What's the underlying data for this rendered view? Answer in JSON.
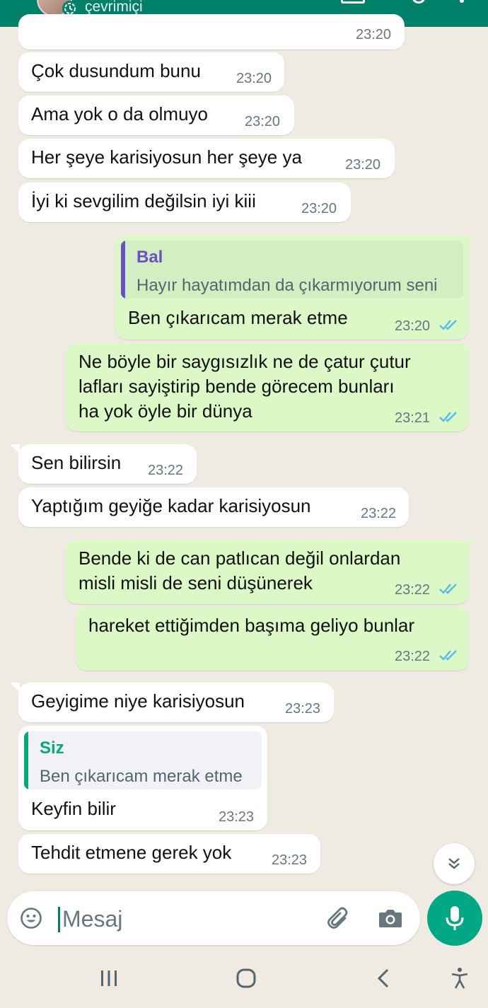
{
  "header": {
    "status": "çevrimiçi"
  },
  "messages": [
    {
      "dir": "in",
      "time": "23:20"
    },
    {
      "dir": "in",
      "text": "Çok dusundum bunu",
      "time": "23:20"
    },
    {
      "dir": "in",
      "text": "Ama yok o da olmuyo",
      "time": "23:20"
    },
    {
      "dir": "in",
      "text": "Her şeye karisiyosun her şeye ya",
      "time": "23:20"
    },
    {
      "dir": "in",
      "text": "İyi ki sevgilim değilsin iyi kiii",
      "time": "23:20"
    },
    {
      "dir": "out",
      "quote": {
        "name": "Bal",
        "text": "Hayır hayatımdan da çıkarmıyorum seni"
      },
      "text": "Ben çıkarıcam merak etme",
      "time": "23:20",
      "status": "read"
    },
    {
      "dir": "out",
      "lines": [
        "Ne böyle bir saygısızlık ne de çatur çutur",
        "lafları sayiştirip bende görecem bunları",
        "ha yok öyle bir dünya"
      ],
      "time": "23:21",
      "status": "read"
    },
    {
      "dir": "in",
      "text": "Sen bilirsin",
      "time": "23:22"
    },
    {
      "dir": "in",
      "text": "Yaptığım geyiğe kadar karisiyosun",
      "time": "23:22"
    },
    {
      "dir": "out",
      "lines": [
        "Bende ki de can patlıcan değil onlardan",
        "misli misli de seni düşünerek"
      ],
      "time": "23:22",
      "status": "read"
    },
    {
      "dir": "out",
      "text": "hareket ettiğimden başıma geliyo bunlar",
      "time": "23:22",
      "status": "read"
    },
    {
      "dir": "in",
      "text": "Geyigime niye karisiyosun",
      "time": "23:23"
    },
    {
      "dir": "in",
      "quote": {
        "name": "Siz",
        "text": "Ben çıkarıcam merak etme"
      },
      "text": "Keyfin bilir",
      "time": "23:23"
    },
    {
      "dir": "in",
      "text": "Tehdit etmene gerek yok",
      "time": "23:23"
    }
  ],
  "input": {
    "placeholder": "Mesaj",
    "value": ""
  },
  "colors": {
    "header": "#008069",
    "chat_bg": "#efeae2",
    "incoming_bubble": "#ffffff",
    "outgoing_bubble": "#dcf8c6",
    "accent": "#00a884",
    "read_ticks": "#53bdeb",
    "quote_name_out": "#6b4ec9",
    "quote_name_in": "#06a77d"
  },
  "icons": {
    "header_status": "status-ring-icon",
    "scroll": "double-chevron-down-icon",
    "emoji": "emoji-icon",
    "attach": "paperclip-icon",
    "camera": "camera-icon",
    "mic": "microphone-icon",
    "nav_recents": "recents-icon",
    "nav_home": "home-icon",
    "nav_back": "back-icon",
    "nav_accessibility": "accessibility-icon"
  }
}
